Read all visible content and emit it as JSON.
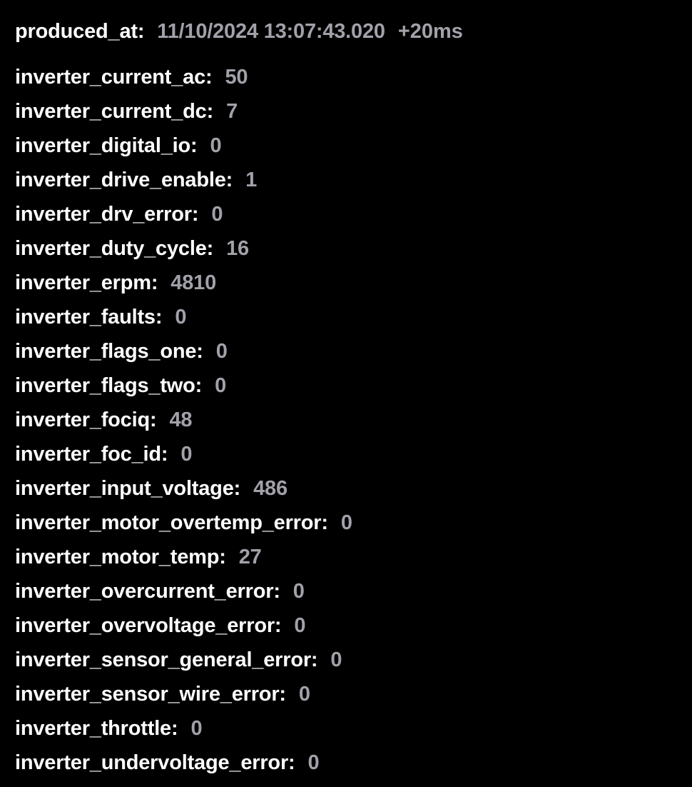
{
  "header": {
    "key": "produced_at:",
    "timestamp": "11/10/2024 13:07:43.020",
    "offset": "+20ms"
  },
  "fields": [
    {
      "key": "inverter_current_ac:",
      "value": "50"
    },
    {
      "key": "inverter_current_dc:",
      "value": "7"
    },
    {
      "key": "inverter_digital_io:",
      "value": "0"
    },
    {
      "key": "inverter_drive_enable:",
      "value": "1"
    },
    {
      "key": "inverter_drv_error:",
      "value": "0"
    },
    {
      "key": "inverter_duty_cycle:",
      "value": "16"
    },
    {
      "key": "inverter_erpm:",
      "value": "4810"
    },
    {
      "key": "inverter_faults:",
      "value": "0"
    },
    {
      "key": "inverter_flags_one:",
      "value": "0"
    },
    {
      "key": "inverter_flags_two:",
      "value": "0"
    },
    {
      "key": "inverter_fociq:",
      "value": "48"
    },
    {
      "key": "inverter_foc_id:",
      "value": "0"
    },
    {
      "key": "inverter_input_voltage:",
      "value": "486"
    },
    {
      "key": "inverter_motor_overtemp_error:",
      "value": "0"
    },
    {
      "key": "inverter_motor_temp:",
      "value": "27"
    },
    {
      "key": "inverter_overcurrent_error:",
      "value": "0"
    },
    {
      "key": "inverter_overvoltage_error:",
      "value": "0"
    },
    {
      "key": "inverter_sensor_general_error:",
      "value": "0"
    },
    {
      "key": "inverter_sensor_wire_error:",
      "value": "0"
    },
    {
      "key": "inverter_throttle:",
      "value": "0"
    },
    {
      "key": "inverter_undervoltage_error:",
      "value": "0"
    }
  ],
  "colors": {
    "background": "#000000",
    "key": "#ffffff",
    "value": "#a1a1aa"
  }
}
